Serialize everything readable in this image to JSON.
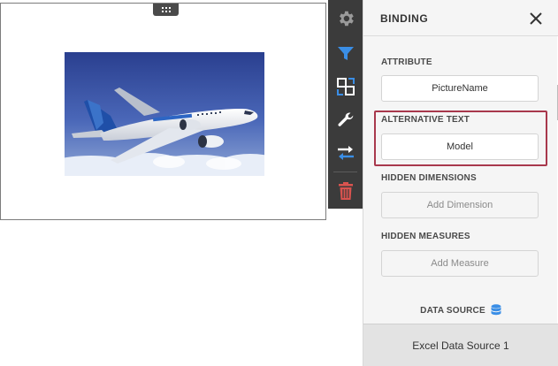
{
  "panel": {
    "title": "BINDING",
    "attribute": {
      "label": "ATTRIBUTE",
      "value": "PictureName"
    },
    "alternative_text": {
      "label": "ALTERNATIVE TEXT",
      "value": "Model"
    },
    "hidden_dimensions": {
      "label": "HIDDEN DIMENSIONS",
      "placeholder": "Add Dimension"
    },
    "hidden_measures": {
      "label": "HIDDEN MEASURES",
      "placeholder": "Add Measure"
    },
    "data_source": {
      "label": "DATA SOURCE",
      "value": "Excel Data Source 1"
    }
  },
  "toolbar": {
    "icons": [
      "gear-icon",
      "filter-icon",
      "convert-icon",
      "wrench-icon",
      "interactivity-icon",
      "delete-icon"
    ]
  },
  "colors": {
    "toolbar_bg": "#3b3b3b",
    "accent_blue": "#3a8ee6",
    "delete_red": "#d9534f",
    "highlight": "#a8384c"
  }
}
